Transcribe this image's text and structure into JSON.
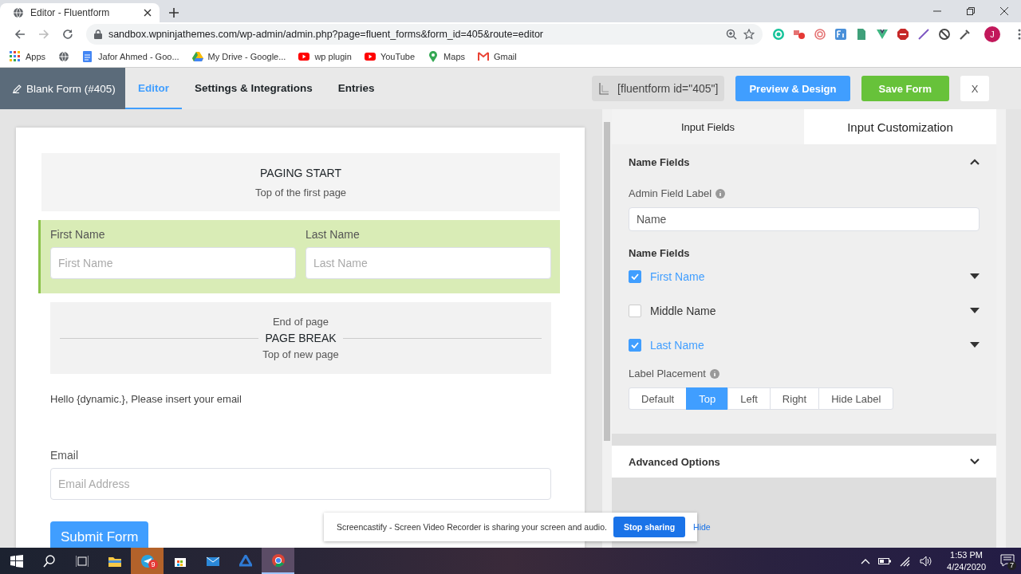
{
  "browser": {
    "tab_title": "Editor - Fluentform",
    "address": "sandbox.wpninjathemes.com/wp-admin/admin.php?page=fluent_forms&form_id=405&route=editor",
    "bookmarks": [
      {
        "label": "Apps"
      },
      {
        "label": "Jafor Ahmed - Goo..."
      },
      {
        "label": "My Drive - Google..."
      },
      {
        "label": "wp plugin"
      },
      {
        "label": "YouTube"
      },
      {
        "label": "Maps"
      },
      {
        "label": "Gmail"
      }
    ],
    "profile_initial": "J"
  },
  "header": {
    "form_title": "Blank Form (#405)",
    "tabs": [
      {
        "label": "Editor",
        "selected": true
      },
      {
        "label": "Settings & Integrations",
        "selected": false
      },
      {
        "label": "Entries",
        "selected": false
      }
    ],
    "shortcode": "[fluentform id=\"405\"]",
    "buttons": [
      {
        "label": "Preview & Design",
        "kind": "primary"
      },
      {
        "label": "Save Form",
        "kind": "success"
      },
      {
        "label": "X",
        "kind": "plain"
      }
    ]
  },
  "form": {
    "elements": [
      {
        "kind": "paging_start",
        "title": "PAGING START",
        "subtitle": "Top of the first page"
      },
      {
        "kind": "name_fields",
        "selected": true,
        "fields": [
          {
            "label": "First Name",
            "placeholder": "First Name"
          },
          {
            "label": "Last Name",
            "placeholder": "Last Name"
          }
        ]
      },
      {
        "kind": "page_break",
        "top": "End of page",
        "title": "PAGE BREAK",
        "bottom": "Top of new page"
      },
      {
        "kind": "html",
        "text": "Hello {dynamic.}, Please insert your email"
      },
      {
        "kind": "email",
        "label": "Email",
        "placeholder": "Email Address"
      },
      {
        "kind": "submit",
        "label": "Submit Form"
      }
    ]
  },
  "panel": {
    "tabs": [
      {
        "label": "Input Fields",
        "selected": false
      },
      {
        "label": "Input Customization",
        "selected": true
      }
    ],
    "section": {
      "title": "Name Fields",
      "expanded": true
    },
    "admin_label": {
      "label": "Admin Field Label",
      "value": "Name"
    },
    "subfields_title": "Name Fields",
    "subfields": [
      {
        "label": "First Name",
        "checked": true
      },
      {
        "label": "Middle Name",
        "checked": false
      },
      {
        "label": "Last Name",
        "checked": true
      }
    ],
    "label_placement": {
      "label": "Label Placement",
      "options": [
        {
          "label": "Default",
          "selected": false
        },
        {
          "label": "Top",
          "selected": true
        },
        {
          "label": "Left",
          "selected": false
        },
        {
          "label": "Right",
          "selected": false
        },
        {
          "label": "Hide Label",
          "selected": false
        }
      ]
    },
    "advanced": {
      "title": "Advanced Options",
      "expanded": false
    }
  },
  "notification": {
    "text": "Screencastify - Screen Video Recorder is sharing your screen and audio.",
    "button": "Stop sharing",
    "link": "Hide"
  },
  "taskbar": {
    "badge": "9",
    "time": "1:53 PM",
    "date": "4/24/2020",
    "notification_count": "7"
  }
}
